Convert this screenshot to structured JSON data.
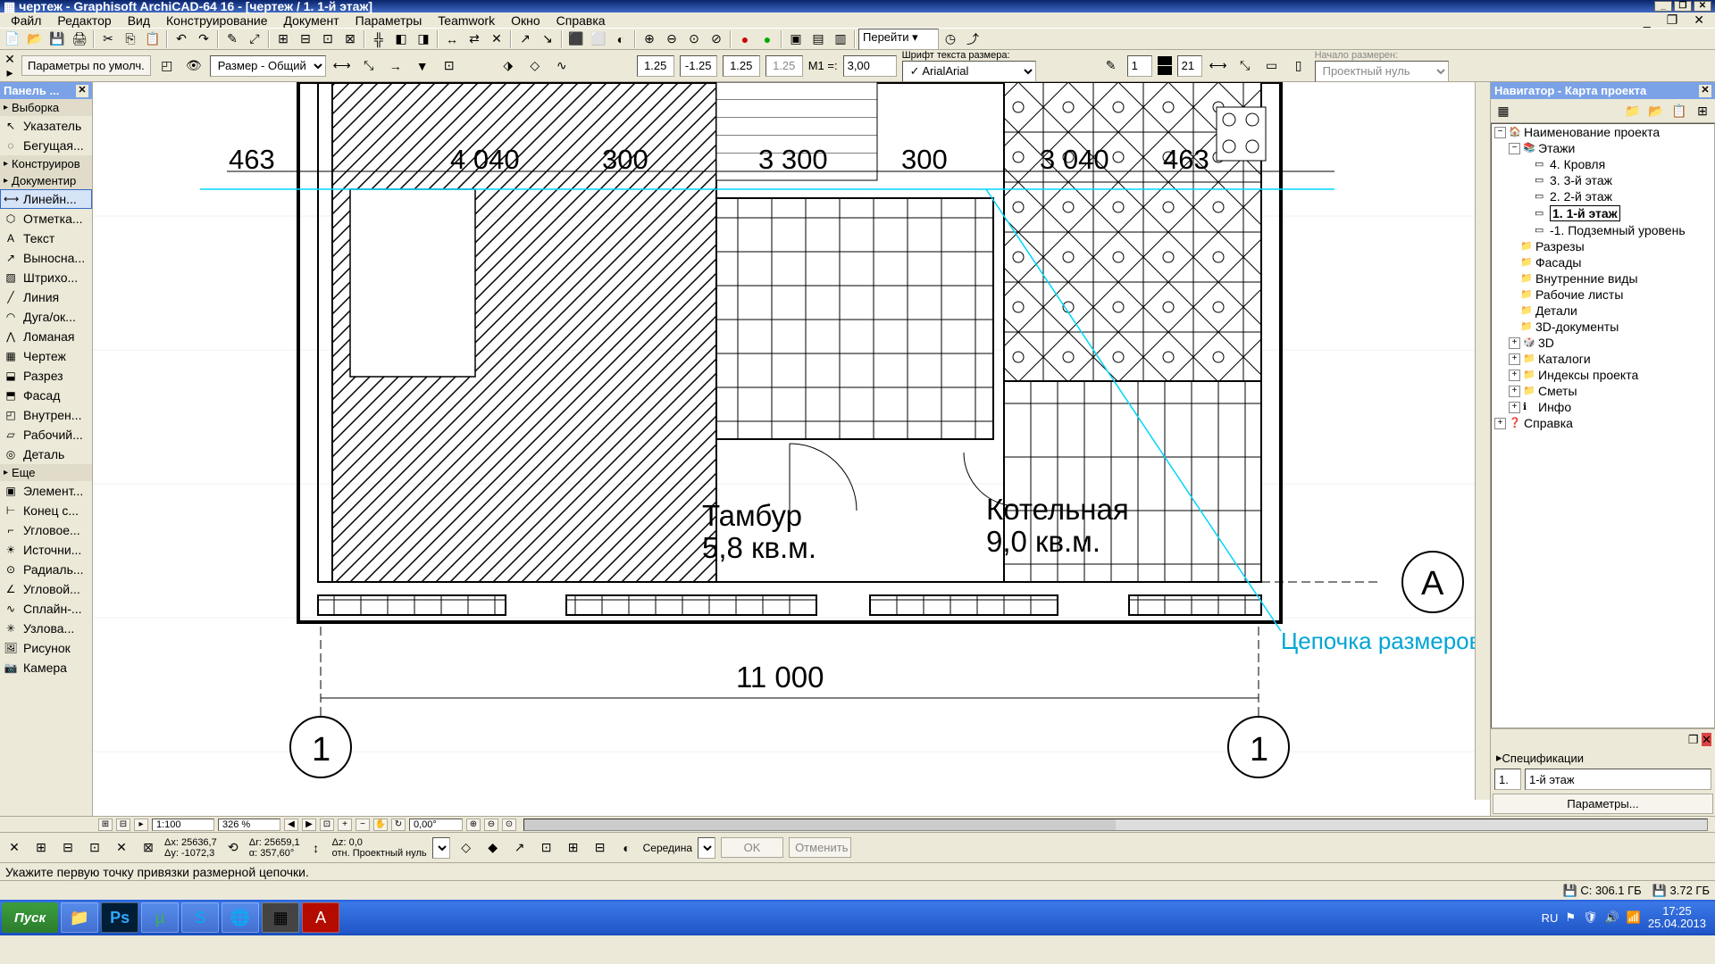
{
  "title": "чертеж - Graphisoft ArchiCAD-64 16 - [чертеж / 1. 1-й этаж]",
  "menu": [
    "Файл",
    "Редактор",
    "Вид",
    "Конструирование",
    "Документ",
    "Параметры",
    "Teamwork",
    "Окно",
    "Справка"
  ],
  "toolbar_goto": "Перейти ▾",
  "param_label": "Параметры по умолч.",
  "dim_header_label": "Шрифт текста размера:",
  "font_value": "Arial",
  "layer_select": "Размер - Общий",
  "scale_prefix": "M1 =:",
  "scale_value": "3,00",
  "dim_vals": {
    "a": "1.25",
    "b": "-1.25",
    "c": "1.25",
    "d": "1.25"
  },
  "pen_vals": {
    "a": "1",
    "b": "21"
  },
  "combo_right": "Проектный нуль",
  "combo_right_label": "Начало размерен:",
  "panels": {
    "left": "Панель ...",
    "nav": "Навигатор - Карта проекта"
  },
  "tool_groups": {
    "select": "Выборка",
    "construct": "Конструиров",
    "document": "Документир",
    "more": "Еще"
  },
  "tools": {
    "pointer": "Указатель",
    "marquee": "Бегущая...",
    "linedim": "Линейн...",
    "elev": "Отметка...",
    "text": "Текст",
    "leader": "Выносна...",
    "hatch": "Штрихо...",
    "line": "Линия",
    "arc": "Дуга/ок...",
    "poly": "Ломаная",
    "draw": "Чертеж",
    "section": "Разрез",
    "facade": "Фасад",
    "interior": "Внутрен...",
    "sheet": "Рабочий...",
    "detail": "Деталь",
    "element": "Элемент...",
    "end": "Конец с...",
    "corner": "Угловое...",
    "source": "Источни...",
    "radial": "Радиаль...",
    "angular": "Угловой...",
    "spline": "Сплайн-...",
    "node": "Узлова...",
    "picture": "Рисунок",
    "camera": "Камера"
  },
  "tree": {
    "root": "Наименование проекта",
    "floors": "Этажи",
    "f4": "4. Кровля",
    "f3": "3. 3-й этаж",
    "f2": "2. 2-й этаж",
    "f1": "1. 1-й этаж",
    "fm1": "-1. Подземный уровень",
    "sections": "Разрезы",
    "facades": "Фасады",
    "interiors": "Внутренние виды",
    "sheets": "Рабочие листы",
    "details": "Детали",
    "docs3d": "3D-документы",
    "3d": "3D",
    "catalogs": "Каталоги",
    "indexes": "Индексы проекта",
    "estimates": "Сметы",
    "info": "Инфо",
    "help": "Справка"
  },
  "specs": {
    "header": "Спецификации",
    "row": "1.",
    "val": "1-й этаж",
    "btn": "Параметры..."
  },
  "drawing": {
    "dims": {
      "d1": "463",
      "d2": "4 040",
      "d3": "300",
      "d4": "3 300",
      "d5": "300",
      "d6": "3 040",
      "d7": "463",
      "total": "11 000"
    },
    "rooms": {
      "r1_name": "Тамбур",
      "r1_area": "5,8 кв.м.",
      "r2_name": "Котельная",
      "r2_area": "9,0 кв.м."
    },
    "axis": {
      "a": "A",
      "one": "1"
    },
    "callout": "Цепочка размеров"
  },
  "zoom": {
    "scale": "1:100",
    "pct": "326 %",
    "angle": "0,00°"
  },
  "coords": {
    "dx": "Δх: 25636,7",
    "dy": "Δу: -1072,3",
    "r": "Δr: 25659,1",
    "a": "α: 357,60°",
    "z": "Δz: 0,0",
    "ref": "отн. Проектный нуль"
  },
  "snap": "Середина",
  "ok": "OK",
  "cancel": "Отменить",
  "hint": "Укажите первую точку привязки размерной цепочки.",
  "disk": {
    "c": "C: 306.1 ГБ",
    "d": "3.72 ГБ"
  },
  "taskbar": {
    "start": "Пуск",
    "lang": "RU",
    "time": "17:25",
    "date": "25.04.2013"
  }
}
